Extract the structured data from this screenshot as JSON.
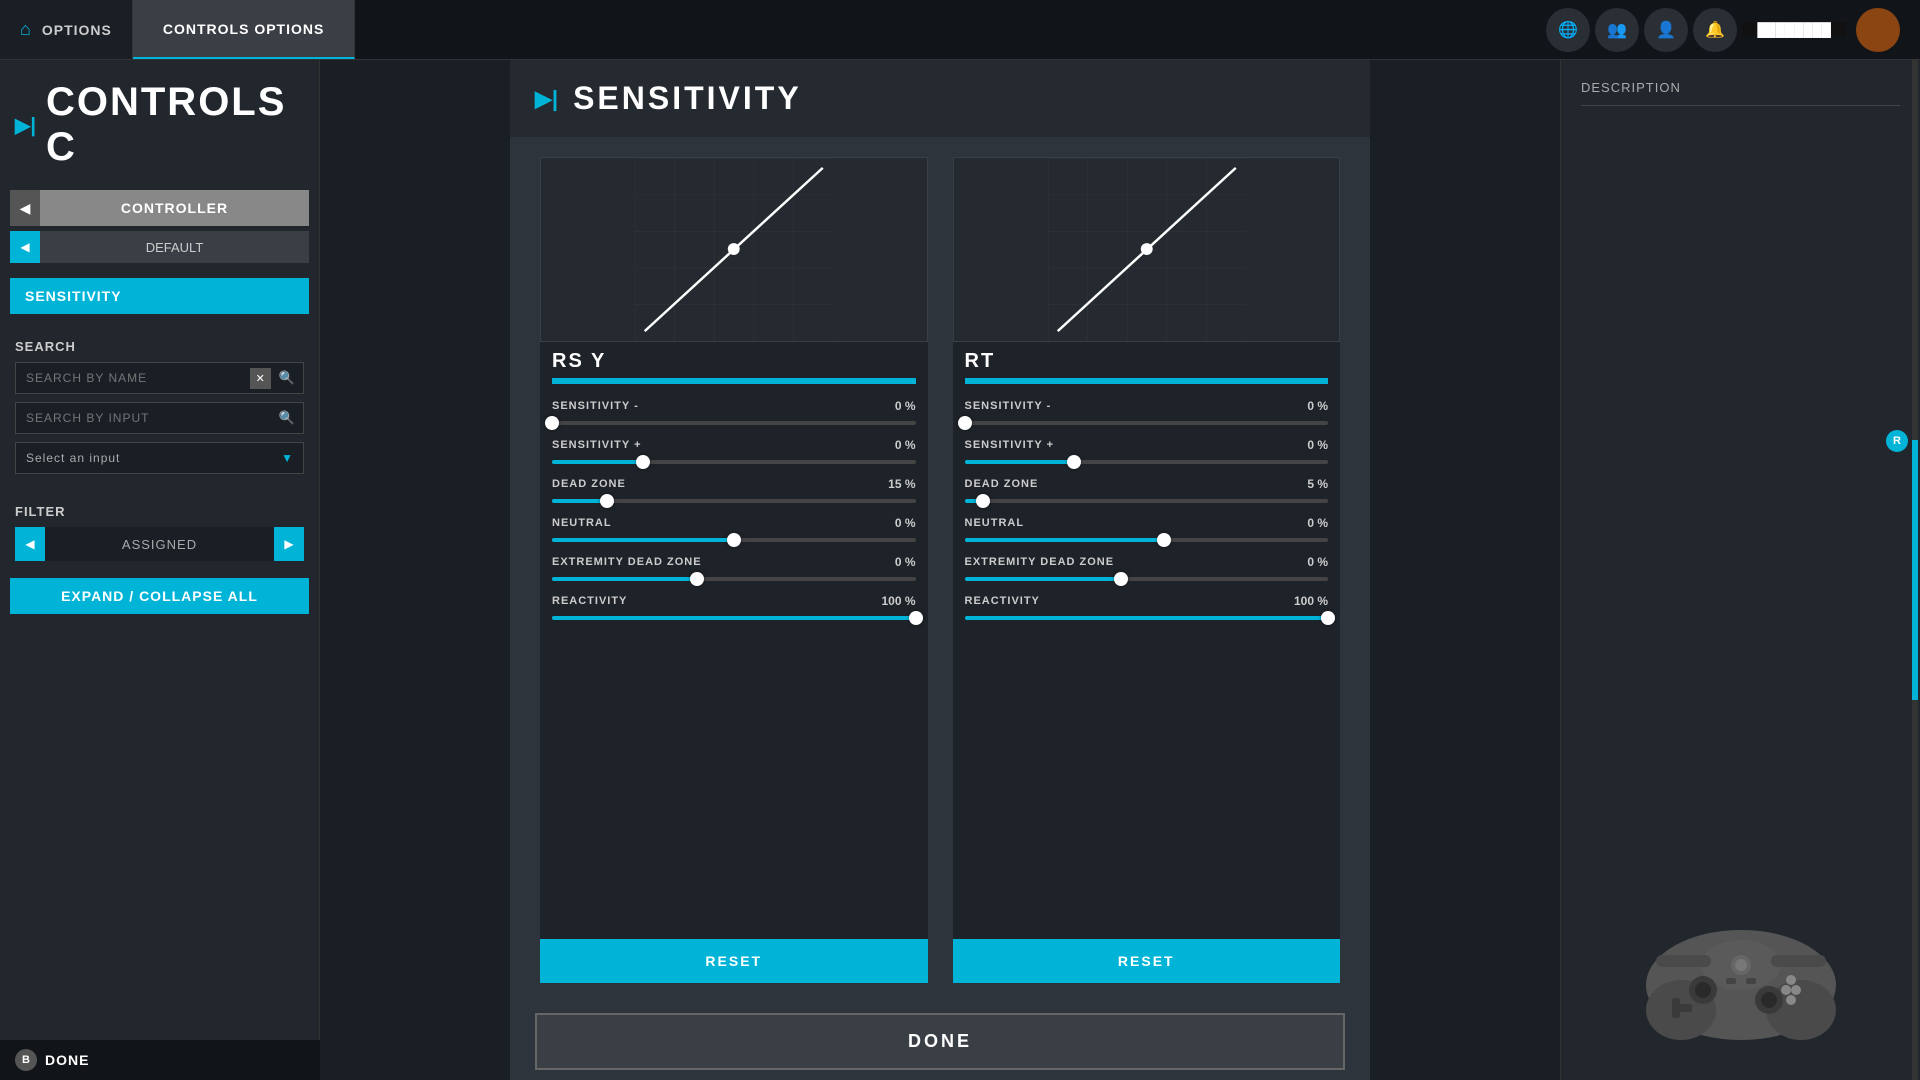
{
  "topbar": {
    "home_label": "OPTIONS",
    "tab_label": "CONTROLS OPTIONS"
  },
  "sidebar": {
    "title": "CONTROLS C",
    "controller_label": "CONTROLLER",
    "default_label": "DEFAULT",
    "sensitivity_label": "SENSITIVITY",
    "search_heading": "SEARCH",
    "search_by_name_placeholder": "SEARCH BY NAME",
    "search_by_input_placeholder": "SEARCH BY INPUT",
    "select_input_label": "Select an input",
    "filter_heading": "FILTER",
    "filter_value": "ASSIGNED",
    "expand_collapse_label": "EXPAND / COLLAPSE ALL"
  },
  "modal": {
    "title": "SENSITIVITY",
    "left_card": {
      "title": "RS Y",
      "sensitivity_minus_label": "SENSITIVITY -",
      "sensitivity_minus_value": "0 %",
      "sensitivity_minus_pct": 0,
      "sensitivity_plus_label": "SENSITIVITY +",
      "sensitivity_plus_value": "0 %",
      "sensitivity_plus_pct": 25,
      "dead_zone_label": "DEAD ZONE",
      "dead_zone_value": "15 %",
      "dead_zone_pct": 15,
      "neutral_label": "NEUTRAL",
      "neutral_value": "0 %",
      "neutral_pct": 50,
      "extremity_label": "EXTREMITY DEAD ZONE",
      "extremity_value": "0 %",
      "extremity_pct": 40,
      "reactivity_label": "REACTIVITY",
      "reactivity_value": "100 %",
      "reactivity_pct": 100,
      "reset_label": "RESET"
    },
    "right_card": {
      "title": "RT",
      "sensitivity_minus_label": "SENSITIVITY -",
      "sensitivity_minus_value": "0 %",
      "sensitivity_minus_pct": 0,
      "sensitivity_plus_label": "SENSITIVITY +",
      "sensitivity_plus_value": "0 %",
      "sensitivity_plus_pct": 30,
      "dead_zone_label": "DEAD ZONE",
      "dead_zone_value": "5 %",
      "dead_zone_pct": 5,
      "neutral_label": "NEUTRAL",
      "neutral_value": "0 %",
      "neutral_pct": 55,
      "extremity_label": "EXTREMITY DEAD ZONE",
      "extremity_value": "0 %",
      "extremity_pct": 43,
      "reactivity_label": "REACTIVITY",
      "reactivity_value": "100 %",
      "reactivity_pct": 100,
      "reset_label": "RESET"
    },
    "done_label": "DONE"
  },
  "right_panel": {
    "description_label": "DESCRIPTION"
  },
  "bottom_bar": {
    "b_label": "B",
    "done_label": "DONE"
  }
}
